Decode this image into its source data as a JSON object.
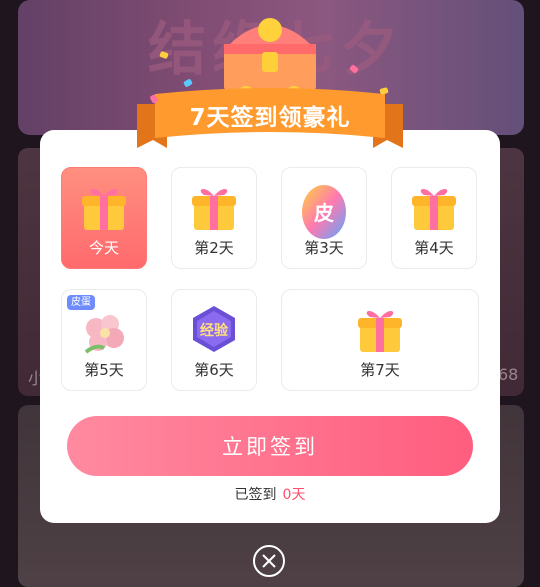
{
  "background": {
    "banner_title": "结缘七夕",
    "corner_left": "小",
    "corner_right": "68"
  },
  "modal": {
    "title": "7天签到领豪礼",
    "days": [
      {
        "label": "今天",
        "reward_icon": "gift-box-icon",
        "state": "today"
      },
      {
        "label": "第2天",
        "reward_icon": "gift-box-icon"
      },
      {
        "label": "第3天",
        "reward_icon": "egg-icon",
        "icon_text": "皮"
      },
      {
        "label": "第4天",
        "reward_icon": "gift-box-icon"
      },
      {
        "label": "第5天",
        "reward_icon": "flower-icon",
        "badge": "皮蛋"
      },
      {
        "label": "第6天",
        "reward_icon": "experience-badge-icon",
        "icon_text": "经验"
      },
      {
        "label": "第7天",
        "reward_icon": "gift-box-icon"
      }
    ],
    "sign_button": "立即签到",
    "signed_prefix": "已签到",
    "signed_count": "0天"
  },
  "colors": {
    "accent": "#ff5d7e",
    "today_tile": "#ff7a74",
    "ribbon": "#ff9a2e"
  }
}
